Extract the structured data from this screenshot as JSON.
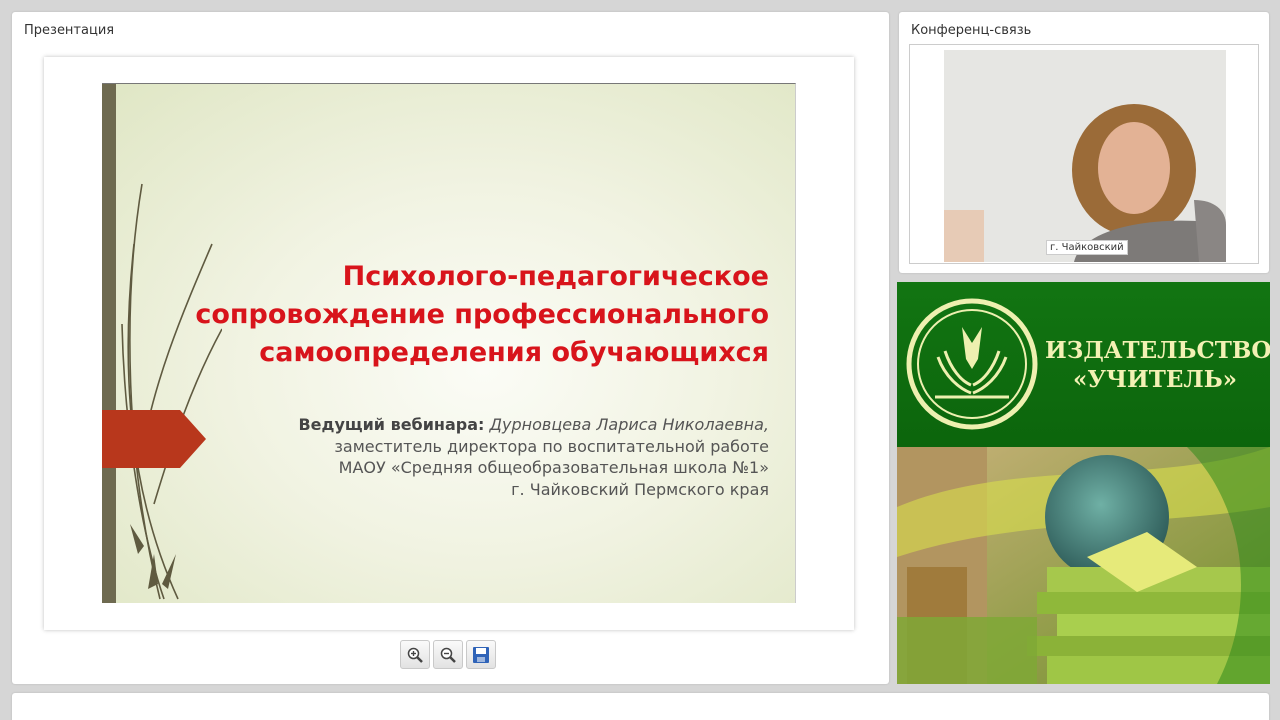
{
  "presentation": {
    "panel_title": "Презентация",
    "slide": {
      "title_lines": [
        "Психолого-педагогическое",
        "сопровождение профессионального",
        "самоопределения обучающихся"
      ],
      "presenter_label": "Ведущий вебинара:",
      "presenter_name": "Дурновцева Лариса Николаевна,",
      "lines": [
        "заместитель директора по воспитательной работе",
        "МАОУ «Средняя общеобразовательная школа №1»",
        "г. Чайковский Пермского края"
      ]
    },
    "toolbar": {
      "zoom_in_icon": "zoom-in-icon",
      "zoom_out_icon": "zoom-out-icon",
      "save_icon": "save-icon"
    }
  },
  "conference": {
    "panel_title": "Конференц-связь",
    "video_caption": "г. Чайковский"
  },
  "banner": {
    "line1": "ИЗДАТЕЛЬСТВО",
    "line2": "«УЧИТЕЛЬ»",
    "colors": {
      "green": "#127512",
      "text": "#f3f1b4"
    }
  },
  "colors": {
    "slide_title": "#d8141b",
    "slide_arrow": "#b8371c",
    "slide_bar": "#6e6a50"
  }
}
